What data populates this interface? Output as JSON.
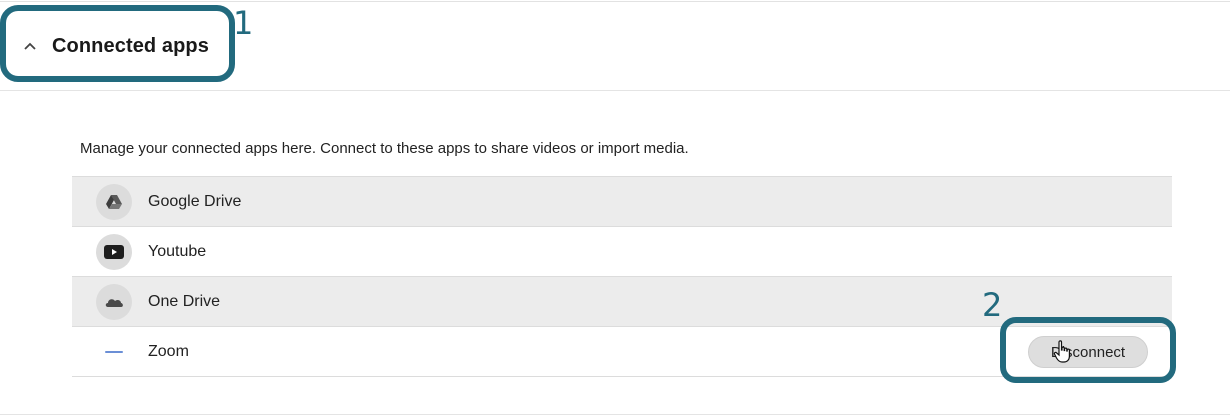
{
  "section": {
    "title": "Connected apps",
    "expanded": true
  },
  "description": "Manage your connected apps here. Connect to these apps to share videos or import media.",
  "apps": [
    {
      "name": "Google Drive",
      "icon": "google-drive-icon"
    },
    {
      "name": "Youtube",
      "icon": "youtube-icon"
    },
    {
      "name": "One Drive",
      "icon": "onedrive-icon"
    },
    {
      "name": "Zoom",
      "icon": "zoom-icon",
      "action_label": "Disconnect"
    }
  ],
  "annotations": [
    {
      "label": "1"
    },
    {
      "label": "2"
    }
  ],
  "colors": {
    "annotation": "#226a7e",
    "row_shade": "#ececec",
    "button_bg": "#dedede"
  }
}
